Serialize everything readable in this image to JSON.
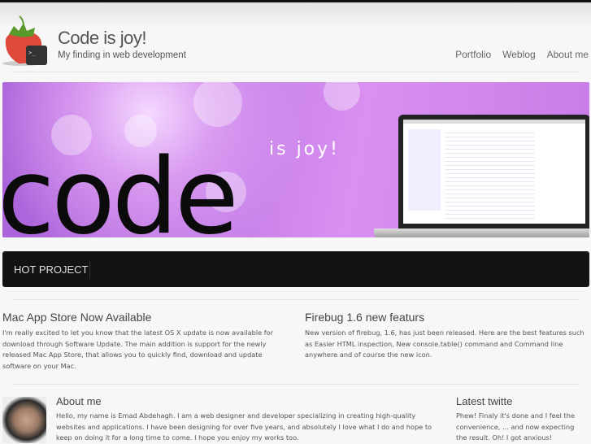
{
  "header": {
    "title": "Code is joy!",
    "tagline": "My finding in web development",
    "nav": [
      "Portfolio",
      "Weblog",
      "About me"
    ]
  },
  "banner": {
    "big_word": "code",
    "small_text": "is joy!"
  },
  "hot_project": {
    "label": "HOT PROJECT"
  },
  "posts": [
    {
      "title": "Mac App Store Now Available",
      "body": "I'm really excited to let you know that the latest OS X update is now available for download through Software Update. The main addition is support for the newly released Mac App Store, that allows you to quickly find, download and update software on your Mac."
    },
    {
      "title": "Firebug 1.6 new featurs",
      "body": "New version of firebug, 1.6, has just been released. Here are the best features such as Easier HTML inspection, New console.table() command and Command line anywhere and of course the new icon."
    }
  ],
  "about": {
    "title": "About me",
    "body": "Hello, my name is Emad Abdehagh. I am a web designer and developer specializing in creating high-quality websites and applications. I have been designing for over five years, and absolutely I love what I do and hope to keep on doing it for a long time to come. I hope you enjoy my works too."
  },
  "twitter": {
    "title": "Latest twitte",
    "body": "Phew! Finaly it's done and I feel the convenience, ... and now expecting the result. Oh! I got anxious!"
  }
}
